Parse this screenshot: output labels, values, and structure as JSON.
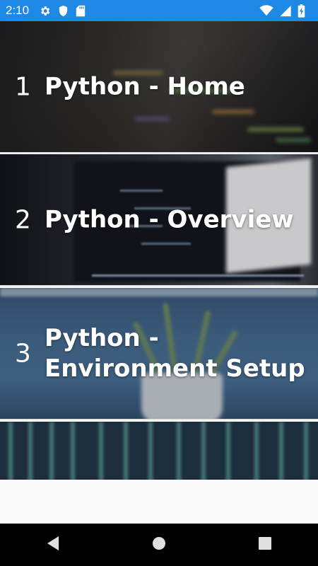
{
  "status_bar": {
    "time": "2:10",
    "left_icons": [
      "gear-icon",
      "shield-icon",
      "sd-card-icon"
    ],
    "right_icons": [
      "wifi-icon",
      "cellular-signal-icon",
      "battery-charging-icon"
    ],
    "background_color": "#1e88e5"
  },
  "items": [
    {
      "number": "1",
      "title": "Python - Home"
    },
    {
      "number": "2",
      "title": "Python - Overview"
    },
    {
      "number": "3",
      "title": "Python - Environment Setup"
    }
  ],
  "nav_bar": {
    "buttons": [
      "back-icon",
      "home-icon",
      "recents-icon"
    ]
  }
}
